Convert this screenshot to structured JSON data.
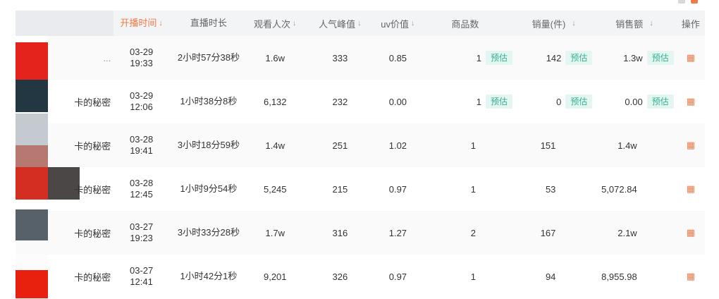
{
  "header": {
    "columns": [
      "开播时间",
      "直播时长",
      "观看人次",
      "人气峰值",
      "uv价值",
      "商品数",
      "销量(件)",
      "销售额",
      "操作"
    ],
    "sort_arrow": "↓"
  },
  "rows": [
    {
      "name": "...",
      "time_date": "03-29",
      "time_clock": "19:33",
      "duration": "2小时57分38秒",
      "views": "1.6w",
      "peak": "333",
      "uv": "0.85",
      "goods": "1",
      "goods_tag": "预估",
      "sales": "142",
      "sales_tag": "预估",
      "amount": "1.3w",
      "amount_tag": "预估"
    },
    {
      "name": "卡的秘密",
      "time_date": "03-29",
      "time_clock": "12:06",
      "duration": "1小时38分8秒",
      "views": "6,132",
      "peak": "232",
      "uv": "0.00",
      "goods": "1",
      "goods_tag": "预估",
      "sales": "0",
      "sales_tag": "预估",
      "amount": "0.00",
      "amount_tag": "预估"
    },
    {
      "name": "卡的秘密",
      "time_date": "03-28",
      "time_clock": "19:41",
      "duration": "3小时18分59秒",
      "views": "1.4w",
      "peak": "251",
      "uv": "1.02",
      "goods": "1",
      "goods_tag": "",
      "sales": "151",
      "sales_tag": "",
      "amount": "1.4w",
      "amount_tag": ""
    },
    {
      "name": "卡的秘密",
      "time_date": "03-28",
      "time_clock": "12:45",
      "duration": "1小时9分54秒",
      "views": "5,245",
      "peak": "215",
      "uv": "0.97",
      "goods": "1",
      "goods_tag": "",
      "sales": "53",
      "sales_tag": "",
      "amount": "5,072.84",
      "amount_tag": ""
    },
    {
      "name": "卡的秘密",
      "time_date": "03-27",
      "time_clock": "19:23",
      "duration": "3小时33分28秒",
      "views": "1.7w",
      "peak": "316",
      "uv": "1.27",
      "goods": "2",
      "goods_tag": "",
      "sales": "167",
      "sales_tag": "",
      "amount": "2.1w",
      "amount_tag": ""
    },
    {
      "name": "卡的秘密",
      "time_date": "03-27",
      "time_clock": "12:41",
      "duration": "1小时42分1秒",
      "views": "9,201",
      "peak": "326",
      "uv": "0.97",
      "goods": "1",
      "goods_tag": "",
      "sales": "94",
      "sales_tag": "",
      "amount": "8,955.98",
      "amount_tag": ""
    }
  ],
  "operation_icon": "gift-icon",
  "colors": {
    "accent": "#f07a4a",
    "tag_bg": "#e4f6f2",
    "tag_text": "#35b291"
  }
}
